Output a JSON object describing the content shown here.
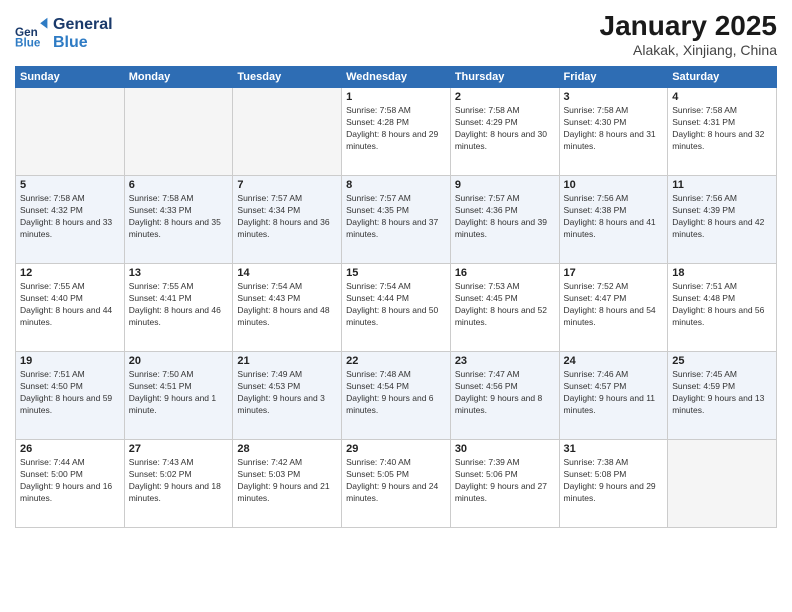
{
  "header": {
    "logo_general": "General",
    "logo_blue": "Blue",
    "month": "January 2025",
    "location": "Alakak, Xinjiang, China"
  },
  "days_of_week": [
    "Sunday",
    "Monday",
    "Tuesday",
    "Wednesday",
    "Thursday",
    "Friday",
    "Saturday"
  ],
  "weeks": [
    [
      {
        "day": "",
        "empty": true
      },
      {
        "day": "",
        "empty": true
      },
      {
        "day": "",
        "empty": true
      },
      {
        "day": "1",
        "sunrise": "Sunrise: 7:58 AM",
        "sunset": "Sunset: 4:28 PM",
        "daylight": "Daylight: 8 hours and 29 minutes."
      },
      {
        "day": "2",
        "sunrise": "Sunrise: 7:58 AM",
        "sunset": "Sunset: 4:29 PM",
        "daylight": "Daylight: 8 hours and 30 minutes."
      },
      {
        "day": "3",
        "sunrise": "Sunrise: 7:58 AM",
        "sunset": "Sunset: 4:30 PM",
        "daylight": "Daylight: 8 hours and 31 minutes."
      },
      {
        "day": "4",
        "sunrise": "Sunrise: 7:58 AM",
        "sunset": "Sunset: 4:31 PM",
        "daylight": "Daylight: 8 hours and 32 minutes."
      }
    ],
    [
      {
        "day": "5",
        "sunrise": "Sunrise: 7:58 AM",
        "sunset": "Sunset: 4:32 PM",
        "daylight": "Daylight: 8 hours and 33 minutes."
      },
      {
        "day": "6",
        "sunrise": "Sunrise: 7:58 AM",
        "sunset": "Sunset: 4:33 PM",
        "daylight": "Daylight: 8 hours and 35 minutes."
      },
      {
        "day": "7",
        "sunrise": "Sunrise: 7:57 AM",
        "sunset": "Sunset: 4:34 PM",
        "daylight": "Daylight: 8 hours and 36 minutes."
      },
      {
        "day": "8",
        "sunrise": "Sunrise: 7:57 AM",
        "sunset": "Sunset: 4:35 PM",
        "daylight": "Daylight: 8 hours and 37 minutes."
      },
      {
        "day": "9",
        "sunrise": "Sunrise: 7:57 AM",
        "sunset": "Sunset: 4:36 PM",
        "daylight": "Daylight: 8 hours and 39 minutes."
      },
      {
        "day": "10",
        "sunrise": "Sunrise: 7:56 AM",
        "sunset": "Sunset: 4:38 PM",
        "daylight": "Daylight: 8 hours and 41 minutes."
      },
      {
        "day": "11",
        "sunrise": "Sunrise: 7:56 AM",
        "sunset": "Sunset: 4:39 PM",
        "daylight": "Daylight: 8 hours and 42 minutes."
      }
    ],
    [
      {
        "day": "12",
        "sunrise": "Sunrise: 7:55 AM",
        "sunset": "Sunset: 4:40 PM",
        "daylight": "Daylight: 8 hours and 44 minutes."
      },
      {
        "day": "13",
        "sunrise": "Sunrise: 7:55 AM",
        "sunset": "Sunset: 4:41 PM",
        "daylight": "Daylight: 8 hours and 46 minutes."
      },
      {
        "day": "14",
        "sunrise": "Sunrise: 7:54 AM",
        "sunset": "Sunset: 4:43 PM",
        "daylight": "Daylight: 8 hours and 48 minutes."
      },
      {
        "day": "15",
        "sunrise": "Sunrise: 7:54 AM",
        "sunset": "Sunset: 4:44 PM",
        "daylight": "Daylight: 8 hours and 50 minutes."
      },
      {
        "day": "16",
        "sunrise": "Sunrise: 7:53 AM",
        "sunset": "Sunset: 4:45 PM",
        "daylight": "Daylight: 8 hours and 52 minutes."
      },
      {
        "day": "17",
        "sunrise": "Sunrise: 7:52 AM",
        "sunset": "Sunset: 4:47 PM",
        "daylight": "Daylight: 8 hours and 54 minutes."
      },
      {
        "day": "18",
        "sunrise": "Sunrise: 7:51 AM",
        "sunset": "Sunset: 4:48 PM",
        "daylight": "Daylight: 8 hours and 56 minutes."
      }
    ],
    [
      {
        "day": "19",
        "sunrise": "Sunrise: 7:51 AM",
        "sunset": "Sunset: 4:50 PM",
        "daylight": "Daylight: 8 hours and 59 minutes."
      },
      {
        "day": "20",
        "sunrise": "Sunrise: 7:50 AM",
        "sunset": "Sunset: 4:51 PM",
        "daylight": "Daylight: 9 hours and 1 minute."
      },
      {
        "day": "21",
        "sunrise": "Sunrise: 7:49 AM",
        "sunset": "Sunset: 4:53 PM",
        "daylight": "Daylight: 9 hours and 3 minutes."
      },
      {
        "day": "22",
        "sunrise": "Sunrise: 7:48 AM",
        "sunset": "Sunset: 4:54 PM",
        "daylight": "Daylight: 9 hours and 6 minutes."
      },
      {
        "day": "23",
        "sunrise": "Sunrise: 7:47 AM",
        "sunset": "Sunset: 4:56 PM",
        "daylight": "Daylight: 9 hours and 8 minutes."
      },
      {
        "day": "24",
        "sunrise": "Sunrise: 7:46 AM",
        "sunset": "Sunset: 4:57 PM",
        "daylight": "Daylight: 9 hours and 11 minutes."
      },
      {
        "day": "25",
        "sunrise": "Sunrise: 7:45 AM",
        "sunset": "Sunset: 4:59 PM",
        "daylight": "Daylight: 9 hours and 13 minutes."
      }
    ],
    [
      {
        "day": "26",
        "sunrise": "Sunrise: 7:44 AM",
        "sunset": "Sunset: 5:00 PM",
        "daylight": "Daylight: 9 hours and 16 minutes."
      },
      {
        "day": "27",
        "sunrise": "Sunrise: 7:43 AM",
        "sunset": "Sunset: 5:02 PM",
        "daylight": "Daylight: 9 hours and 18 minutes."
      },
      {
        "day": "28",
        "sunrise": "Sunrise: 7:42 AM",
        "sunset": "Sunset: 5:03 PM",
        "daylight": "Daylight: 9 hours and 21 minutes."
      },
      {
        "day": "29",
        "sunrise": "Sunrise: 7:40 AM",
        "sunset": "Sunset: 5:05 PM",
        "daylight": "Daylight: 9 hours and 24 minutes."
      },
      {
        "day": "30",
        "sunrise": "Sunrise: 7:39 AM",
        "sunset": "Sunset: 5:06 PM",
        "daylight": "Daylight: 9 hours and 27 minutes."
      },
      {
        "day": "31",
        "sunrise": "Sunrise: 7:38 AM",
        "sunset": "Sunset: 5:08 PM",
        "daylight": "Daylight: 9 hours and 29 minutes."
      },
      {
        "day": "",
        "empty": true
      }
    ]
  ]
}
